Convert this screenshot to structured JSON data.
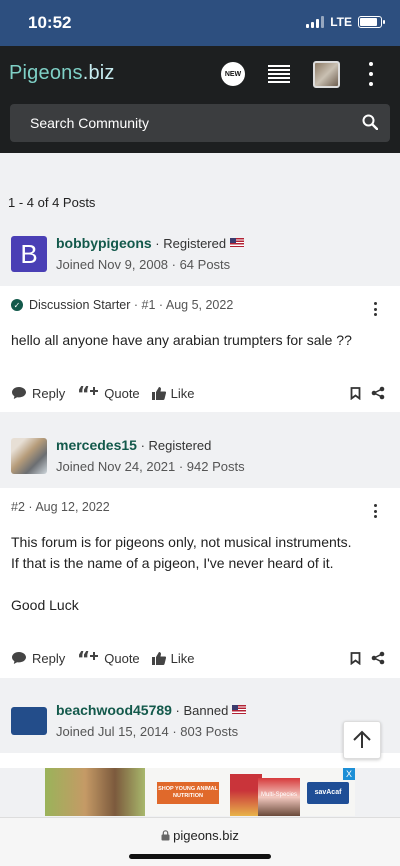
{
  "status_bar": {
    "time": "10:52",
    "network": "LTE",
    "battery_level": 0.85
  },
  "header": {
    "logo_main": "Pigeons",
    "logo_tld": ".biz",
    "new_badge": "NEW",
    "search_placeholder": "Search Community"
  },
  "thread": {
    "posts_count": "1 - 4 of 4 Posts",
    "posts": [
      {
        "avatar_letter": "B",
        "username": "bobbypigeons",
        "role": " · Registered",
        "meta": "Joined Nov 9, 2008 · 64 Posts",
        "post_meta_prefix": "Discussion Starter",
        "post_meta": " · #1 · Aug 5, 2022",
        "body": [
          "hello all anyone have any arabian trumpters for sale ??"
        ]
      },
      {
        "username": "mercedes15",
        "role": " · Registered",
        "meta": "Joined Nov 24, 2021 · 942 Posts",
        "post_meta": "#2 · Aug 12, 2022",
        "body": [
          "This forum is for pigeons only, not musical instruments.",
          "If that is the name of a pigeon, I've never heard of it.",
          "",
          "Good Luck"
        ]
      },
      {
        "username": "beachwood45789",
        "role": " · Banned",
        "meta": "Joined Jul 15, 2014 · 803 Posts"
      }
    ],
    "actions": {
      "reply": "Reply",
      "quote": "Quote",
      "like": "Like"
    }
  },
  "ad": {
    "cta": "SHOP YOUNG ANIMAL NUTRITION",
    "product": "Multi-Species",
    "brand": "savAcaf",
    "close": "X"
  },
  "browser": {
    "url": "pigeons.biz"
  }
}
